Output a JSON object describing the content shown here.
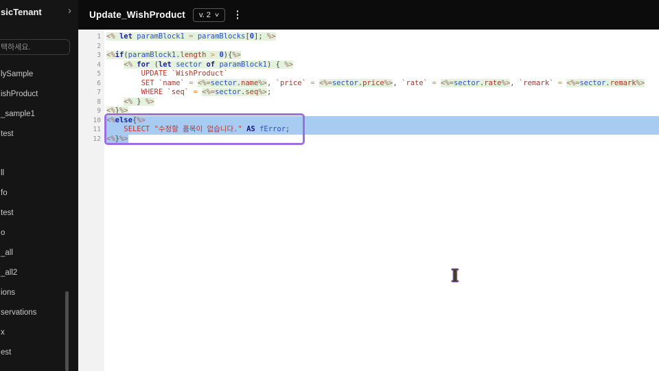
{
  "sidebar": {
    "tenant": "sicTenant",
    "chevron": "›",
    "search_placeholder": "택하세요.",
    "groups": [
      {
        "items": [
          "lySample",
          "ishProduct",
          "_sample1",
          "test"
        ]
      },
      {
        "items": [
          "ll",
          "fo",
          "test",
          "o",
          "_all",
          "_all2",
          "ions",
          "servations",
          "x",
          "est"
        ]
      }
    ]
  },
  "header": {
    "title": "Update_WishProduct",
    "version_label": "v. 2",
    "version_caret": "∨"
  },
  "cursor": {
    "glyph": "I"
  },
  "colors": {
    "selection_blue": "#a8cbf2",
    "annotation_purple": "#9b6fe0",
    "template_bg_green": "#e4f1dc",
    "sidebar_bg": "#151515",
    "header_bg": "#0c0c0c"
  },
  "editor": {
    "lines": [
      {
        "n": 1,
        "tokens": [
          [
            "<%",
            "delim g"
          ],
          [
            " ",
            "g"
          ],
          [
            "let",
            "kw g"
          ],
          [
            " ",
            "g"
          ],
          [
            "paramBlock1",
            "var g"
          ],
          [
            " ",
            "g"
          ],
          [
            "=",
            "op g"
          ],
          [
            " ",
            "g"
          ],
          [
            "paramBlocks",
            "var g"
          ],
          [
            "[",
            "punc g"
          ],
          [
            "0",
            "num g"
          ],
          [
            "]",
            "punc g"
          ],
          [
            ";",
            "punc g"
          ],
          [
            " ",
            "g"
          ],
          [
            "%>",
            "delim g"
          ]
        ]
      },
      {
        "n": 2,
        "tokens": []
      },
      {
        "n": 3,
        "tokens": [
          [
            "<%",
            "delim g"
          ],
          [
            "if",
            "kw g"
          ],
          [
            "(",
            "punc g"
          ],
          [
            "paramBlock1",
            "var g"
          ],
          [
            ".",
            "punc g"
          ],
          [
            "length",
            "prop g"
          ],
          [
            " ",
            "g"
          ],
          [
            ">",
            "op g"
          ],
          [
            " ",
            "g"
          ],
          [
            "0",
            "num g"
          ],
          [
            ")",
            "punc g"
          ],
          [
            "{",
            "punc g"
          ],
          [
            "%>",
            "delim g"
          ]
        ]
      },
      {
        "n": 4,
        "tokens": [
          [
            "    ",
            ""
          ],
          [
            "<%",
            "delim g"
          ],
          [
            " ",
            "g"
          ],
          [
            "for",
            "kw g"
          ],
          [
            " ",
            "g"
          ],
          [
            "(",
            "punc g"
          ],
          [
            "let",
            "kw g"
          ],
          [
            " ",
            "g"
          ],
          [
            "sector",
            "var g"
          ],
          [
            " ",
            "g"
          ],
          [
            "of",
            "kw g"
          ],
          [
            " ",
            "g"
          ],
          [
            "paramBlock1",
            "var g"
          ],
          [
            ")",
            "punc g"
          ],
          [
            " ",
            "g"
          ],
          [
            "{",
            "punc g"
          ],
          [
            " ",
            "g"
          ],
          [
            "%>",
            "delim g"
          ]
        ]
      },
      {
        "n": 5,
        "tokens": [
          [
            "        ",
            ""
          ],
          [
            "UPDATE",
            "sql"
          ],
          [
            " ",
            ""
          ],
          [
            "`WishProduct`",
            "tick"
          ]
        ]
      },
      {
        "n": 6,
        "tokens": [
          [
            "        ",
            ""
          ],
          [
            "SET",
            "sql"
          ],
          [
            " ",
            ""
          ],
          [
            "`name`",
            "tick"
          ],
          [
            " ",
            ""
          ],
          [
            "=",
            "op"
          ],
          [
            " ",
            ""
          ],
          [
            "<%=",
            "delim g"
          ],
          [
            "sector",
            "var g"
          ],
          [
            ".",
            "punc g"
          ],
          [
            "name",
            "prop g"
          ],
          [
            "%>",
            "delim g"
          ],
          [
            ",",
            "punc"
          ],
          [
            " ",
            ""
          ],
          [
            "`price`",
            "tick"
          ],
          [
            " ",
            ""
          ],
          [
            "=",
            "op"
          ],
          [
            " ",
            ""
          ],
          [
            "<%=",
            "delim g"
          ],
          [
            "sector",
            "var g"
          ],
          [
            ".",
            "punc g"
          ],
          [
            "price",
            "prop g"
          ],
          [
            "%>",
            "delim g"
          ],
          [
            ",",
            "punc"
          ],
          [
            " ",
            ""
          ],
          [
            "`rate`",
            "tick"
          ],
          [
            " ",
            ""
          ],
          [
            "=",
            "op"
          ],
          [
            " ",
            ""
          ],
          [
            "<%=",
            "delim g"
          ],
          [
            "sector",
            "var g"
          ],
          [
            ".",
            "punc g"
          ],
          [
            "rate",
            "prop g"
          ],
          [
            "%>",
            "delim g"
          ],
          [
            ",",
            "punc"
          ],
          [
            " ",
            ""
          ],
          [
            "`remark`",
            "tick"
          ],
          [
            " ",
            ""
          ],
          [
            "=",
            "op"
          ],
          [
            " ",
            ""
          ],
          [
            "<%=",
            "delim g"
          ],
          [
            "sector",
            "var g"
          ],
          [
            ".",
            "punc g"
          ],
          [
            "remark",
            "prop g"
          ],
          [
            "%>",
            "delim g"
          ]
        ]
      },
      {
        "n": 7,
        "tokens": [
          [
            "        ",
            ""
          ],
          [
            "WHERE",
            "sql"
          ],
          [
            " ",
            ""
          ],
          [
            "`seq`",
            "tick"
          ],
          [
            " ",
            ""
          ],
          [
            "=",
            "op"
          ],
          [
            " ",
            ""
          ],
          [
            "<%=",
            "delim g"
          ],
          [
            "sector",
            "var g"
          ],
          [
            ".",
            "punc g"
          ],
          [
            "seq",
            "prop g"
          ],
          [
            "%>",
            "delim g"
          ],
          [
            ";",
            "punc"
          ]
        ]
      },
      {
        "n": 8,
        "tokens": [
          [
            "    ",
            ""
          ],
          [
            "<%",
            "delim g"
          ],
          [
            " ",
            "g"
          ],
          [
            "}",
            "punc g"
          ],
          [
            " ",
            "g"
          ],
          [
            "%>",
            "delim g"
          ]
        ]
      },
      {
        "n": 9,
        "tokens": [
          [
            "<%",
            "delim g"
          ],
          [
            "}",
            "punc g"
          ],
          [
            "%>",
            "delim g"
          ]
        ]
      },
      {
        "n": 10,
        "sel": "full",
        "tokens": [
          [
            "<%",
            "delim"
          ],
          [
            "else",
            "kw"
          ],
          [
            "{",
            "punc"
          ],
          [
            "%>",
            "delim"
          ]
        ]
      },
      {
        "n": 11,
        "sel": "full",
        "tokens": [
          [
            "    ",
            ""
          ],
          [
            "SELECT",
            "sql"
          ],
          [
            " ",
            ""
          ],
          [
            "\"수정할 품목이 없습니다.\"",
            "str"
          ],
          [
            " ",
            ""
          ],
          [
            "AS",
            "askw"
          ],
          [
            " ",
            ""
          ],
          [
            "fError",
            "var"
          ],
          [
            ";",
            "punc"
          ]
        ]
      },
      {
        "n": 12,
        "sel": "text",
        "tokens": [
          [
            "<%",
            "delim"
          ],
          [
            "}",
            "punc"
          ],
          [
            "%>",
            "delim"
          ]
        ]
      }
    ]
  }
}
